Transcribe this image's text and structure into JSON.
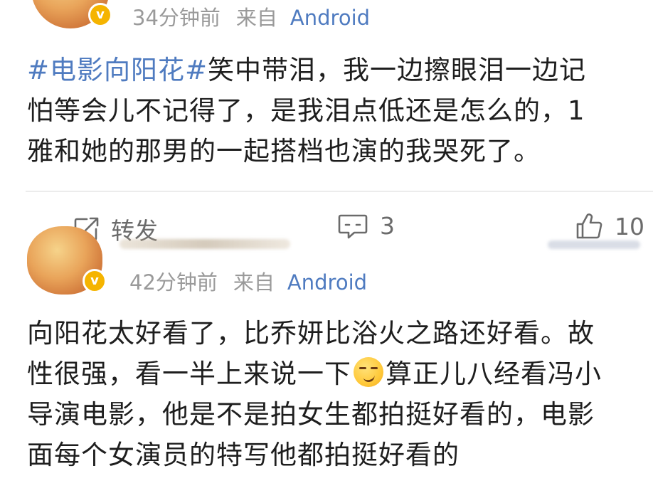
{
  "post1": {
    "time": "34分钟前",
    "from_label": "来自",
    "source": "Android",
    "hashtag": "#电影向阳花#",
    "line1_rest": "笑中带泪，我一边擦眼泪一边记",
    "line2": "怕等会儿不记得了，是我泪点低还是怎么的，1",
    "line3": "雅和她的那男的一起搭档也演的我哭死了。"
  },
  "actions": {
    "repost_label": "转发",
    "comment_count": "3",
    "like_count": "10"
  },
  "post2": {
    "time": "42分钟前",
    "from_label": "来自",
    "source": "Android",
    "line1": "向阳花太好看了，比乔妍比浴火之路还好看。故",
    "line2_before": "性很强，看一半上来说一下",
    "emoji_name": "smirk-emoji",
    "line2_after": "算正儿八经看冯小",
    "line3": "导演电影，他是不是拍女生都拍挺好看的，电影",
    "line4": "面每个女演员的特写他都拍挺好看的"
  },
  "colors": {
    "link_blue": "#4f7bc0",
    "meta_gray": "#9a9a9a",
    "text_dark": "#1e1e1e",
    "vip_badge": "#f5b400"
  }
}
